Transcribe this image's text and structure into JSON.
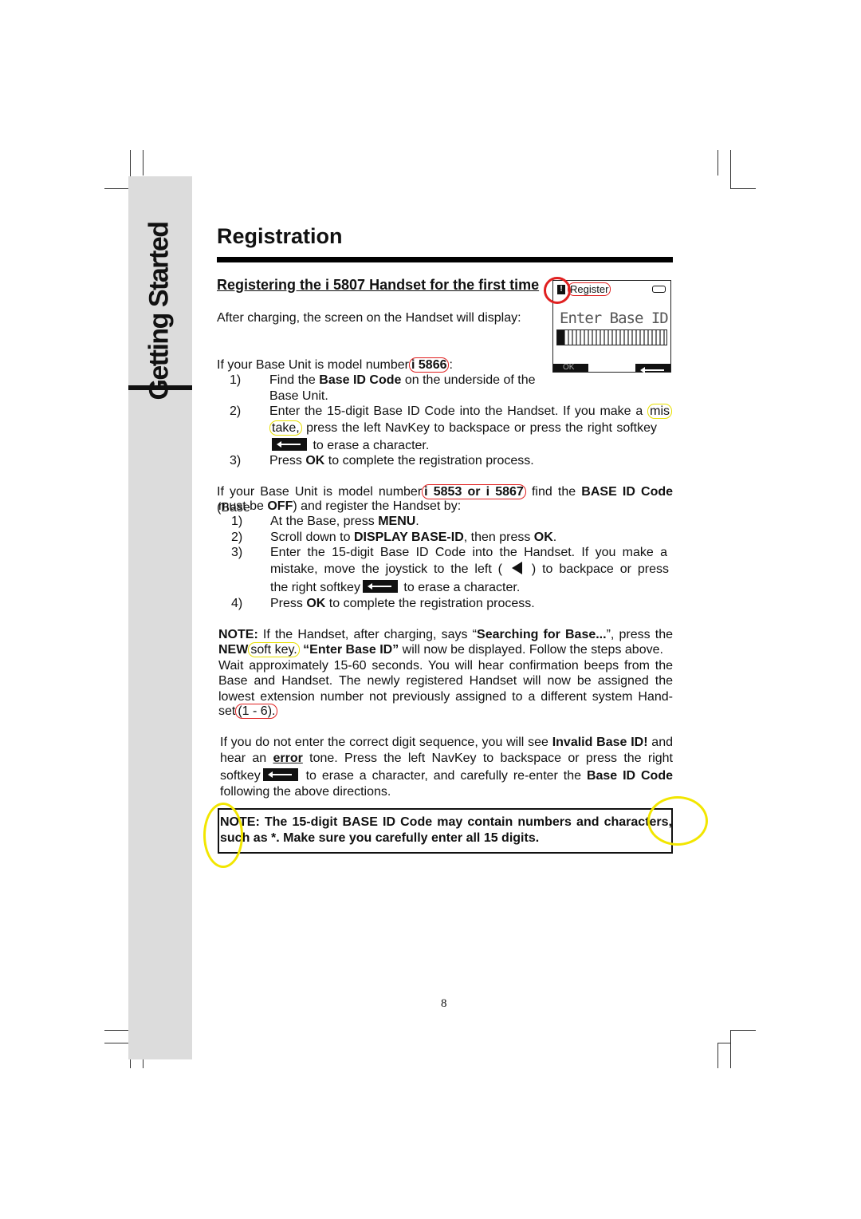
{
  "side_tab": "Getting Started",
  "title": "Registration",
  "subheading": "Registering the i 5807 Handset for the first time",
  "screen": {
    "header": "Register",
    "prompt": "Enter Base ID",
    "left_softkey": "OK",
    "icons": [
      "alert-icon",
      "battery-icon",
      "backspace-arrow-icon"
    ]
  },
  "lines": [
    [
      [
        "t",
        "After charging, the screen on the Handset will display:"
      ]
    ],
    [
      [
        "t",
        "If your Base Unit is model number"
      ],
      [
        "rb",
        "i 5866"
      ],
      [
        "t",
        ":"
      ]
    ],
    [
      [
        "t",
        "Find the "
      ],
      [
        "b",
        "Base ID Code"
      ],
      [
        "t",
        " on the underside of the"
      ]
    ],
    [
      [
        "t",
        "Base Unit."
      ]
    ],
    [
      [
        "t",
        "Enter the 15-digit Base ID Code into the Handset. If you make a "
      ],
      [
        "y",
        "mis"
      ]
    ],
    [
      [
        "y",
        "take,"
      ],
      [
        "t",
        " press the left NavKey to backspace or press the right softkey"
      ]
    ],
    [
      [
        "sk",
        ""
      ],
      [
        "t",
        " to erase a character."
      ]
    ],
    [
      [
        "t",
        "Press "
      ],
      [
        "b",
        "OK"
      ],
      [
        "t",
        " to complete the registration process."
      ]
    ],
    [
      [
        "t",
        "If your Base Unit is model number"
      ],
      [
        "rb",
        "i 5853 or i 5867"
      ],
      [
        "t",
        " find the "
      ],
      [
        "b",
        "BASE ID Code"
      ],
      [
        "t",
        " (Base"
      ]
    ],
    [
      [
        "t",
        "must be "
      ],
      [
        "b",
        "OFF"
      ],
      [
        "t",
        ") and register the Handset by:"
      ]
    ],
    [
      [
        "t",
        "At the Base, press "
      ],
      [
        "b",
        "MENU"
      ],
      [
        "t",
        "."
      ]
    ],
    [
      [
        "t",
        "Scroll down to "
      ],
      [
        "b",
        "DISPLAY BASE-ID"
      ],
      [
        "t",
        ", then press "
      ],
      [
        "b",
        "OK"
      ],
      [
        "t",
        "."
      ]
    ],
    [
      [
        "t",
        "Enter the 15-digit Base ID Code into the Handset. If you make a"
      ]
    ],
    [
      [
        "t",
        "mistake, move the joystick to the left ( "
      ],
      [
        "la",
        ""
      ],
      [
        "t",
        " )  to backpace or press"
      ]
    ],
    [
      [
        "t",
        "the right softkey"
      ],
      [
        "sk",
        ""
      ],
      [
        "t",
        " to erase a character."
      ]
    ],
    [
      [
        "t",
        "Press "
      ],
      [
        "b",
        "OK"
      ],
      [
        "t",
        " to complete the registration process."
      ]
    ],
    [
      [
        "b",
        "NOTE:"
      ],
      [
        "t",
        " If the Handset, after charging, says “"
      ],
      [
        "b",
        "Searching for Base..."
      ],
      [
        "t",
        "”, press the"
      ]
    ],
    [
      [
        "b",
        "NEW"
      ],
      [
        "y",
        "soft key."
      ],
      [
        "b",
        " “Enter Base ID”"
      ],
      [
        "t",
        " will now be displayed. Follow the steps above."
      ]
    ],
    [
      [
        "t",
        "Wait approximately 15-60 seconds. You will hear confirmation beeps from the"
      ]
    ],
    [
      [
        "t",
        "Base and Handset. The newly registered Handset will now be assigned the"
      ]
    ],
    [
      [
        "t",
        "lowest extension number not previously assigned to a different system Hand-"
      ]
    ],
    [
      [
        "t",
        "set"
      ],
      [
        "r",
        "(1 - 6)."
      ]
    ],
    [
      [
        "t",
        "If you do not enter the correct digit sequence, you will see "
      ],
      [
        "b",
        "Invalid Base ID!"
      ],
      [
        "t",
        " and"
      ]
    ],
    [
      [
        "t",
        "hear an "
      ],
      [
        "bu",
        "error"
      ],
      [
        "t",
        " tone. Press the left NavKey to backspace or press the right"
      ]
    ],
    [
      [
        "t",
        "softkey"
      ],
      [
        "sk",
        ""
      ],
      [
        "t",
        " to erase a character, and carefully re-enter the "
      ],
      [
        "b",
        "Base ID Code"
      ]
    ],
    [
      [
        "t",
        "following the above directions."
      ]
    ],
    [
      [
        "b",
        "NOTE: The 15-digit BASE ID Code may contain numbers and characters,"
      ]
    ],
    [
      [
        "b",
        "such as *.  Make sure you carefully enter all 15 digits."
      ]
    ]
  ],
  "list_numbers": [
    "1)",
    "2)",
    "3)",
    "1)",
    "2)",
    "3)",
    "4)"
  ],
  "page_number": "8"
}
